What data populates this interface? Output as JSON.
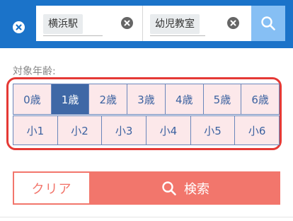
{
  "header": {
    "location_value": "横浜駅",
    "keyword_value": "幼児教室",
    "close_icon": "close-icon",
    "search_icon": "search-icon"
  },
  "age_filter": {
    "label": "対象年齢:",
    "ages": [
      {
        "label": "0歳",
        "selected": false
      },
      {
        "label": "1歳",
        "selected": true
      },
      {
        "label": "2歳",
        "selected": false
      },
      {
        "label": "3歳",
        "selected": false
      },
      {
        "label": "4歳",
        "selected": false
      },
      {
        "label": "5歳",
        "selected": false
      },
      {
        "label": "6歳",
        "selected": false
      }
    ],
    "grades": [
      {
        "label": "小1",
        "selected": false
      },
      {
        "label": "小2",
        "selected": false
      },
      {
        "label": "小3",
        "selected": false
      },
      {
        "label": "小4",
        "selected": false
      },
      {
        "label": "小5",
        "selected": false
      },
      {
        "label": "小6",
        "selected": false
      }
    ]
  },
  "actions": {
    "clear_label": "クリア",
    "search_label": "検索"
  },
  "colors": {
    "header_bg": "#1b73c9",
    "search_button_bg": "#86bff4",
    "highlight_frame": "#e53935",
    "cell_bg": "#fce8ea",
    "selected_bg": "#3f68a6",
    "accent": "#f2766c"
  }
}
